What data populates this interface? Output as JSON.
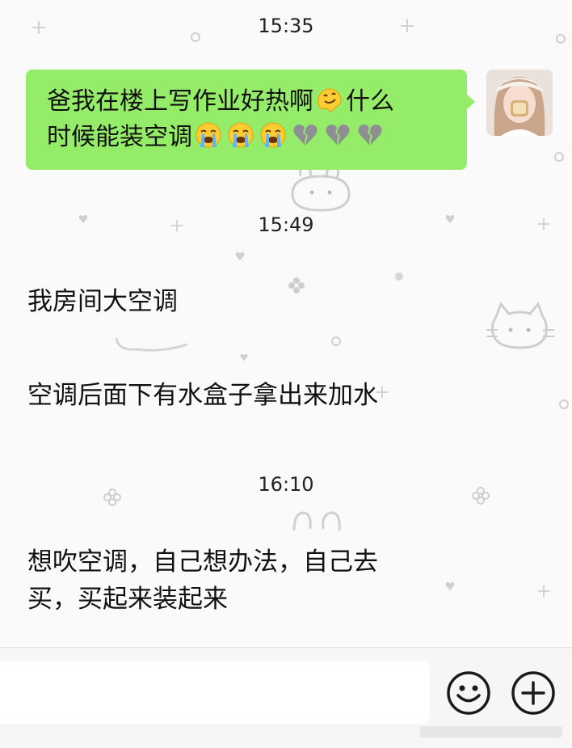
{
  "messages": {
    "time_1": "15:35",
    "outgoing": {
      "line1": "爸我在楼上写作业好热啊",
      "after_emoji": "什么",
      "line2": "时候能装空调",
      "emoji_1": "melting-face",
      "emojis_crying": [
        "loudly-crying-face",
        "loudly-crying-face",
        "loudly-crying-face"
      ],
      "emojis_heart": [
        "broken-heart",
        "broken-heart",
        "broken-heart"
      ]
    },
    "time_2": "15:49",
    "incoming_1": "我房间大空调",
    "incoming_2": "空调后面下有水盒子拿出来加水",
    "time_3": "16:10",
    "incoming_3_line1": "想吹空调，自己想办法，自己去",
    "incoming_3_line2": "买，买起来装起来"
  },
  "toolbar": {
    "emoji_icon": "smiley-face-icon",
    "plus_icon": "plus-circle-icon"
  },
  "colors": {
    "outgoing_bubble": "#95ec69",
    "background": "#fafafa"
  }
}
